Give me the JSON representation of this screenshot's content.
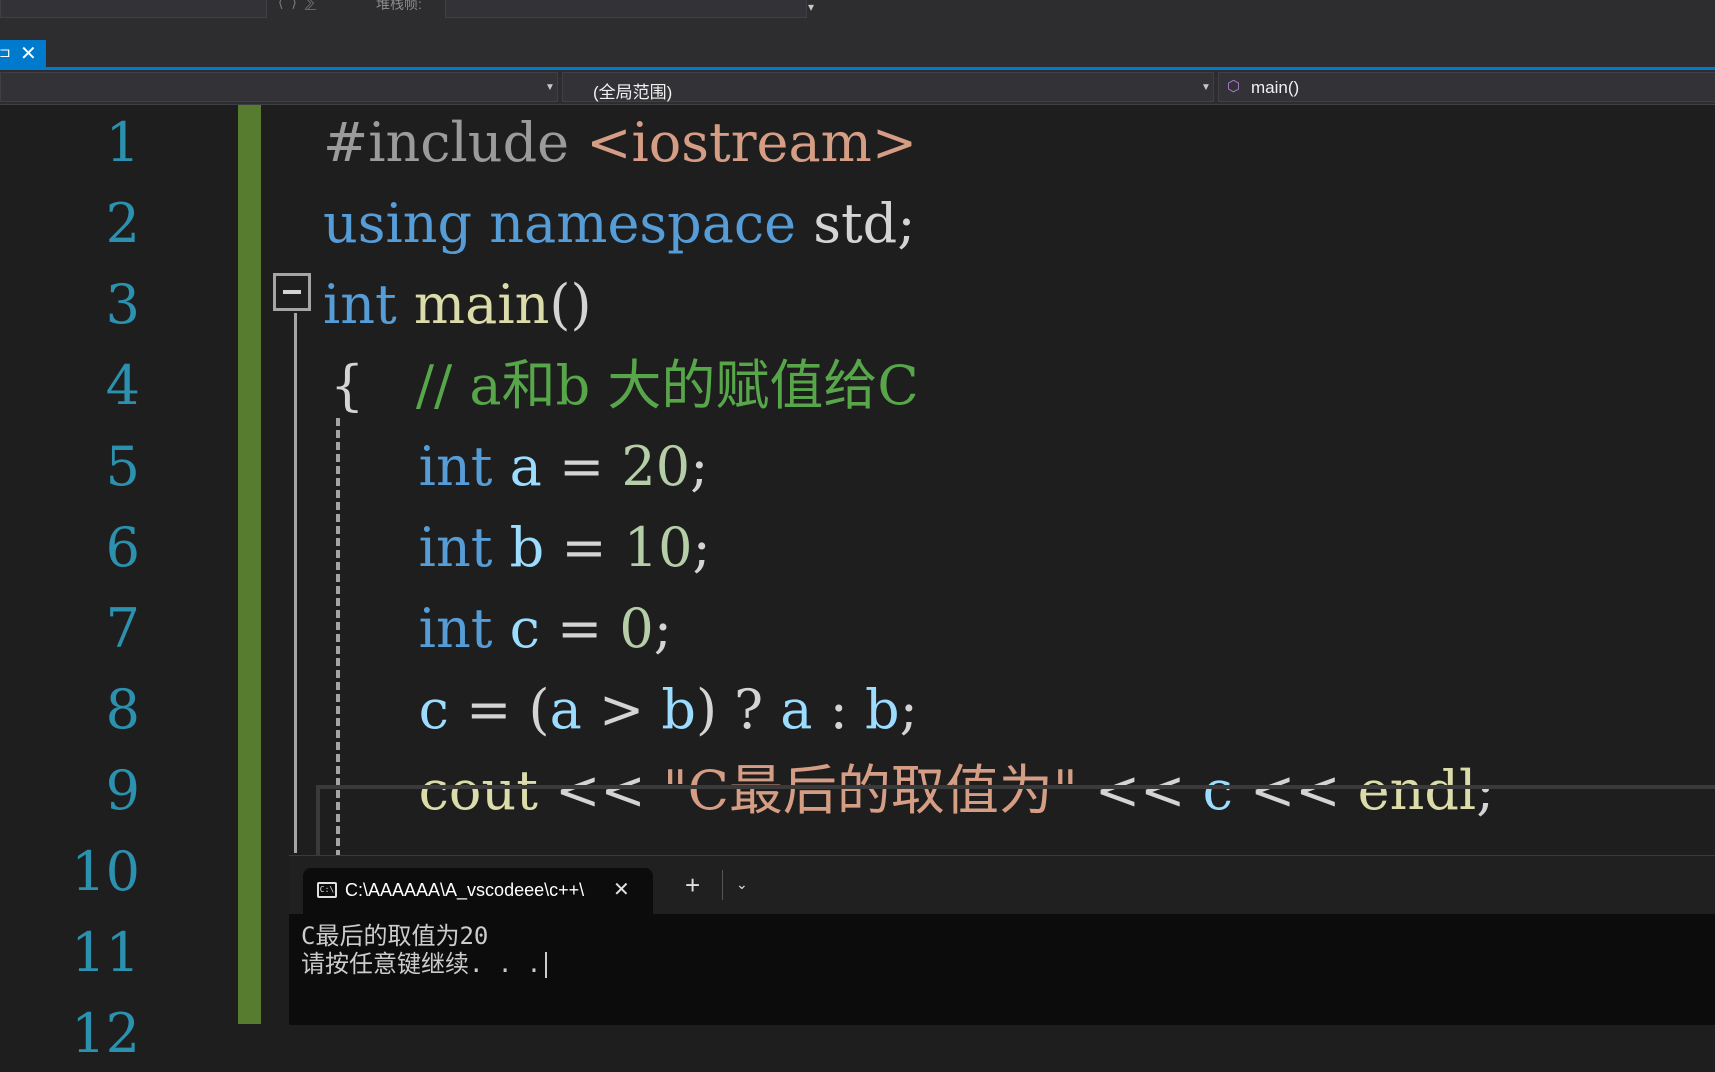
{
  "toolbar": {
    "ghost_icons": "⟨ ⟩ ⅀",
    "stack_frame_label": "堆栈帧:",
    "overflow_glyph": "▾"
  },
  "tab": {
    "pin_glyph": "⊐",
    "close_glyph": "✕"
  },
  "navbar": {
    "project_dropdown_value": "",
    "scope_dropdown_value": "(全局范围)",
    "member_dropdown_value": "main()",
    "member_icon": "cube-icon"
  },
  "editor": {
    "line_numbers": [
      "1",
      "2",
      "3",
      "4",
      "5",
      "6",
      "7",
      "8",
      "9",
      "10",
      "11",
      "12"
    ],
    "fold_glyph": "−",
    "lines": [
      [
        [
          "pp",
          "#include "
        ],
        [
          "str",
          "<iostream>"
        ]
      ],
      [
        [
          "kw",
          "using "
        ],
        [
          "kw",
          "namespace "
        ],
        [
          "pl",
          "std;"
        ]
      ],
      [
        [
          "kw",
          "int "
        ],
        [
          "fnn",
          "main"
        ],
        [
          "pl",
          "()"
        ]
      ],
      [
        [
          "pl",
          "{   "
        ],
        [
          "cm",
          "// a和b 大的赋值给C"
        ]
      ],
      [
        [
          "pl",
          "    "
        ],
        [
          "kw",
          "int "
        ],
        [
          "var",
          "a"
        ],
        [
          "pl",
          " = "
        ],
        [
          "num",
          "20"
        ],
        [
          "pl",
          ";"
        ]
      ],
      [
        [
          "pl",
          "    "
        ],
        [
          "kw",
          "int "
        ],
        [
          "var",
          "b"
        ],
        [
          "pl",
          " = "
        ],
        [
          "num",
          "10"
        ],
        [
          "pl",
          ";"
        ]
      ],
      [
        [
          "pl",
          "    "
        ],
        [
          "kw",
          "int "
        ],
        [
          "var",
          "c"
        ],
        [
          "pl",
          " = "
        ],
        [
          "num",
          "0"
        ],
        [
          "pl",
          ";"
        ]
      ],
      [
        [
          "pl",
          "    "
        ],
        [
          "var",
          "c"
        ],
        [
          "pl",
          " = ("
        ],
        [
          "var",
          "a"
        ],
        [
          "pl",
          " > "
        ],
        [
          "var",
          "b"
        ],
        [
          "pl",
          ") ? "
        ],
        [
          "var",
          "a"
        ],
        [
          "pl",
          " : "
        ],
        [
          "var",
          "b"
        ],
        [
          "pl",
          ";"
        ]
      ],
      [
        [
          "pl",
          "    "
        ],
        [
          "fnn",
          "cout"
        ],
        [
          "pl",
          " << "
        ],
        [
          "str",
          "\"C最后的取值为\""
        ],
        [
          "pl",
          " << "
        ],
        [
          "var",
          "c"
        ],
        [
          "pl",
          " << "
        ],
        [
          "fnn",
          "endl"
        ],
        [
          "pl",
          ";"
        ]
      ]
    ]
  },
  "terminal": {
    "tab_title": "C:\\AAAAAA\\A_vscodeee\\c++\\",
    "tab_icon_text": "C:\\",
    "close_glyph": "✕",
    "new_tab_glyph": "+",
    "dropdown_glyph": "⌄",
    "output_line1": "C最后的取值为20",
    "output_line2": "请按任意键继续. . ."
  },
  "colors": {
    "accent": "#007acc",
    "keyword": "#569cd6",
    "string": "#d69d85",
    "comment": "#57a64a",
    "function": "#dcdcaa",
    "variable": "#9cdcfe",
    "number": "#b5cea8",
    "line_number": "#2b91af",
    "change_margin": "#587c2f"
  }
}
